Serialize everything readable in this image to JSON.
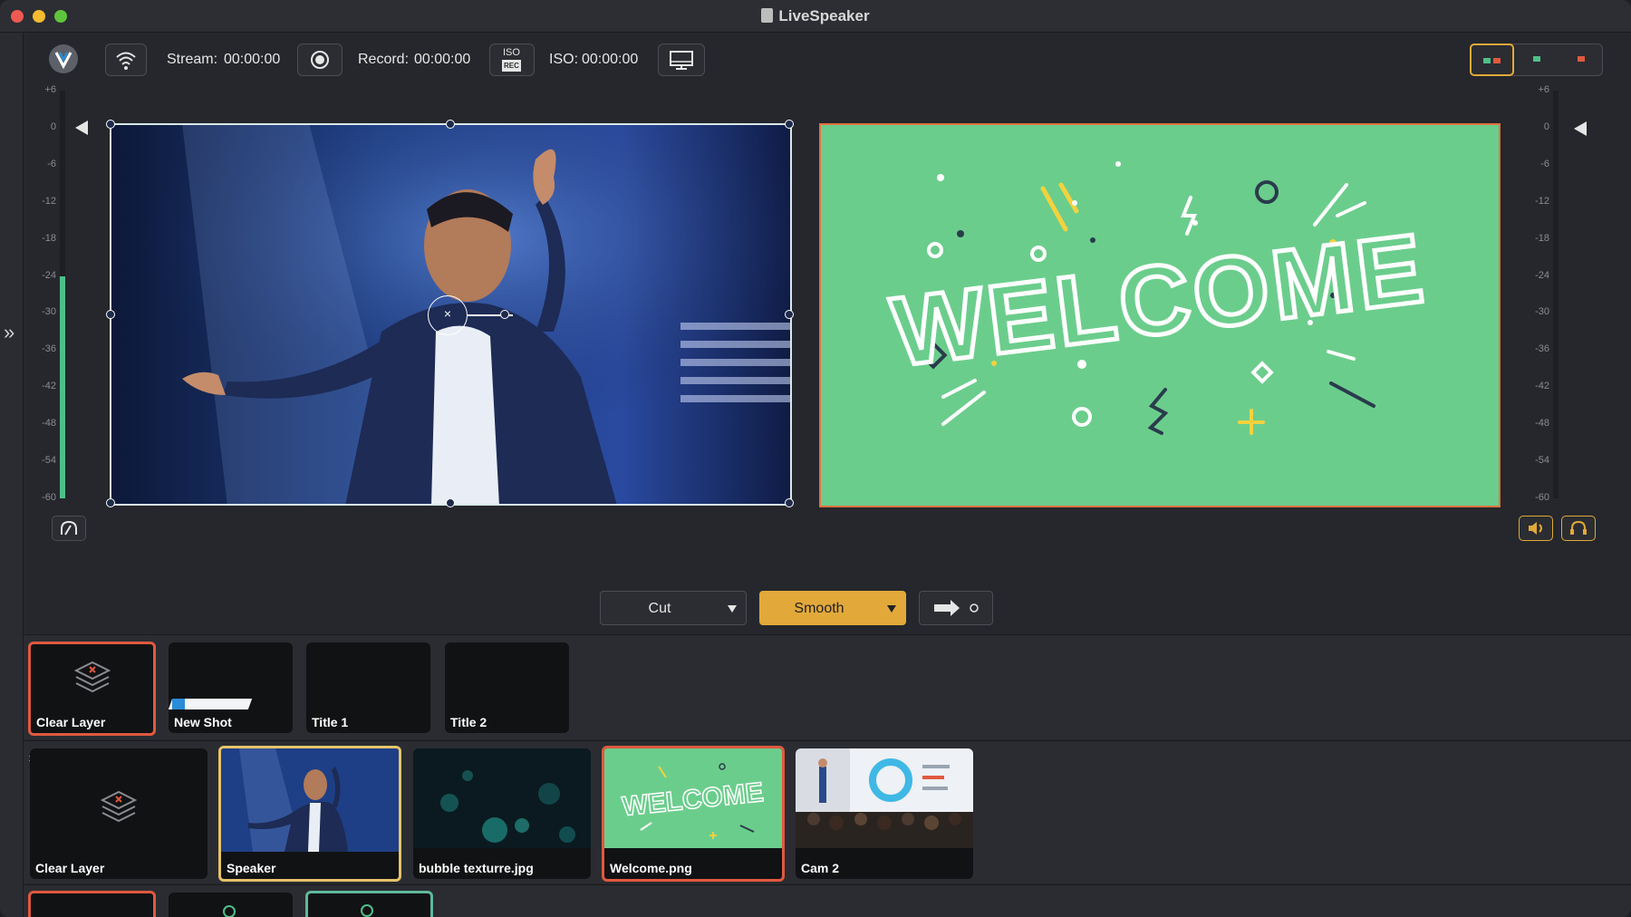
{
  "window": {
    "title": "LiveSpeaker"
  },
  "toolbar": {
    "stream_label": "Stream:",
    "stream_time": "00:00:00",
    "record_label": "Record:",
    "record_time": "00:00:00",
    "iso_label": "ISO:",
    "iso_time": "00:00:00",
    "iso_badge": "ISO",
    "iso_badge_sub": "REC"
  },
  "meter": {
    "ticks": [
      "+6",
      "0",
      "-6",
      "-12",
      "-18",
      "-24",
      "-30",
      "-36",
      "-42",
      "-48",
      "-54",
      "-60"
    ],
    "left_level_db": -24,
    "right_level_db": -60
  },
  "program": {
    "text": "WELCOME"
  },
  "transition": {
    "cut_label": "Cut",
    "smooth_label": "Smooth"
  },
  "rows": {
    "row1": [
      {
        "name": "Clear Layer",
        "state": "live"
      },
      {
        "name": "New Shot",
        "state": "none"
      },
      {
        "name": "Title 1",
        "state": "none"
      },
      {
        "name": "Title 2",
        "state": "none"
      }
    ],
    "row2": [
      {
        "name": "Clear Layer",
        "state": "none"
      },
      {
        "name": "Speaker",
        "state": "preview"
      },
      {
        "name": "bubble texturre.jpg",
        "state": "none"
      },
      {
        "name": "Welcome.png",
        "state": "live"
      },
      {
        "name": "Cam 2",
        "state": "none"
      }
    ],
    "thumb_welcome_text": "WELCOME"
  },
  "colors": {
    "accent": "#e2a93a",
    "live": "#e0593f",
    "program_bg": "#6bcd8c",
    "meter": "#4fbf8a"
  }
}
